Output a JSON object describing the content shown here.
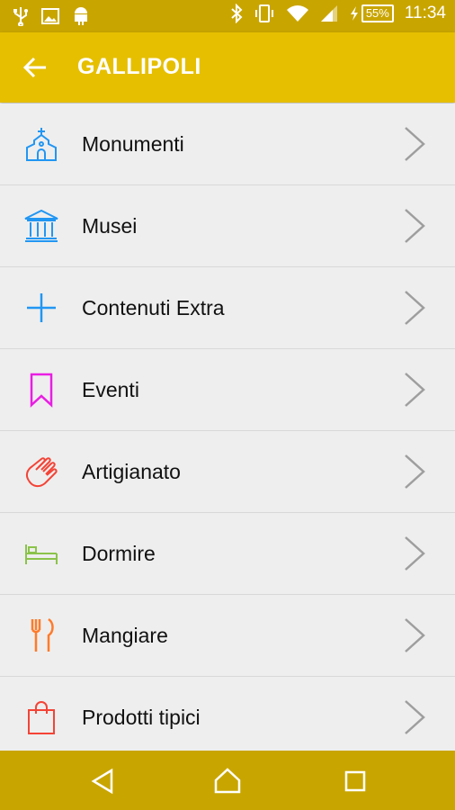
{
  "status": {
    "time": "11:34",
    "battery": "55%",
    "icons": [
      "usb-icon",
      "image-icon",
      "android-icon",
      "bluetooth-icon",
      "vibrate-icon",
      "wifi-icon",
      "signal-icon",
      "charging-icon"
    ]
  },
  "header": {
    "title": "GALLIPOLI",
    "back_icon": "arrow-left-icon"
  },
  "menu": {
    "items": [
      {
        "label": "Monumenti",
        "icon": "church-icon",
        "color": "#2196f3"
      },
      {
        "label": "Musei",
        "icon": "museum-icon",
        "color": "#2196f3"
      },
      {
        "label": "Contenuti Extra",
        "icon": "plus-icon",
        "color": "#2196f3"
      },
      {
        "label": "Eventi",
        "icon": "bookmark-icon",
        "color": "#e91ee3"
      },
      {
        "label": "Artigianato",
        "icon": "hand-icon",
        "color": "#f44336"
      },
      {
        "label": "Dormire",
        "icon": "bed-icon",
        "color": "#8bc34a"
      },
      {
        "label": "Mangiare",
        "icon": "cutlery-icon",
        "color": "#ff7b2a"
      },
      {
        "label": "Prodotti tipici",
        "icon": "shopping-bag-icon",
        "color": "#f44336"
      }
    ]
  },
  "colors": {
    "status_bar": "#c9a500",
    "app_bar": "#e6bf00",
    "nav_bar": "#c9a500",
    "background": "#eeeeee"
  },
  "nav": {
    "icons": [
      "back-triangle-icon",
      "home-icon",
      "recents-square-icon"
    ]
  }
}
